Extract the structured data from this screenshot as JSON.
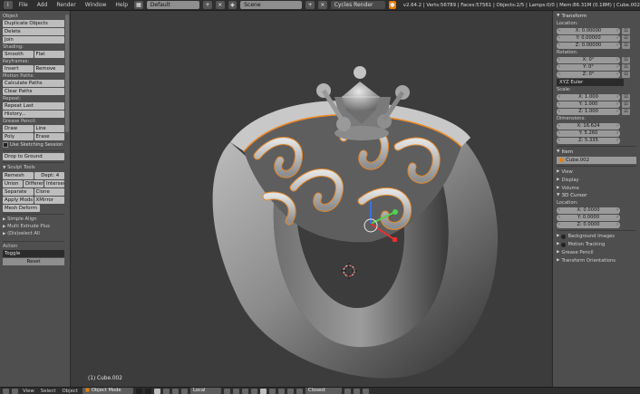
{
  "topbar": {
    "menus": [
      "File",
      "Add",
      "Render",
      "Window",
      "Help"
    ],
    "layout": "Default",
    "scene": "Scene",
    "engine": "Cycles Render",
    "stats": "v2.64.2 | Verts:56789 | Faces:57561 | Objects:2/5 | Lamps:0/0 | Mem:86.31M (0.18M) | Cube.002"
  },
  "toolshelf": {
    "top_label": "Object",
    "object_buttons": [
      "Duplicate Objects",
      "Delete",
      "Join"
    ],
    "shading_label": "Shading:",
    "shading_buttons": [
      "Smooth",
      "Flat"
    ],
    "keyframes_label": "Keyframes:",
    "keyframe_buttons": [
      "Insert",
      "Remove"
    ],
    "motion_label": "Motion Paths:",
    "motion_buttons": [
      "Calculate Paths",
      "Clear Paths"
    ],
    "repeat_label": "Repeat:",
    "repeat_buttons": [
      "Repeat Last",
      "History..."
    ],
    "grease_label": "Grease Pencil:",
    "grease_row1": [
      "Draw",
      "Line"
    ],
    "grease_row2": [
      "Poly",
      "Erase"
    ],
    "sketching_label": "Use Sketching Session",
    "drop_button": "Drop to Ground",
    "sculpt_panel": "Sculpt Tools",
    "remesh_button": "Remesh",
    "depth_value": "Dept: 4",
    "bool_row": [
      "Union",
      "Difference",
      "Intersect"
    ],
    "sep_row": [
      "Separate",
      "Clone"
    ],
    "mods_row": [
      "Apply Mods",
      "XMirror"
    ],
    "mesh_deform": "Mesh Deform",
    "collapsed": [
      "Simple Align",
      "Multi Extrude Plus",
      "(Dis)select All"
    ],
    "action_label": "Action",
    "action_value": "Toggle",
    "reset_button": "Reset"
  },
  "viewport": {
    "object_label": "(1) Cube.002"
  },
  "properties": {
    "transform_title": "Transform",
    "location_label": "Location:",
    "location": [
      "X: 0.00000",
      "Y: 0.00000",
      "Z: 0.00000"
    ],
    "rotation_label": "Rotation:",
    "rotation": [
      "X: 0°",
      "Y: 0°",
      "Z: 0°"
    ],
    "rotation_mode": "XYZ Euler",
    "scale_label": "Scale:",
    "scale": [
      "X: 1.000",
      "Y: 1.000",
      "Z: 1.000"
    ],
    "dimensions_label": "Dimensions:",
    "dimensions": [
      "X: 16.624",
      "Y: 5.260",
      "Z: 5.335"
    ],
    "item_title": "Item",
    "item_name": "Cube.002",
    "view_sections": [
      "View",
      "Display",
      "Volume"
    ],
    "cursor_title": "3D Cursor",
    "cursor_location_label": "Location:",
    "cursor_location": [
      "X: 0.0000",
      "Y: 0.0000",
      "Z: 0.0000"
    ],
    "extra_sections": [
      "Background Images",
      "Motion Tracking",
      "Grease Pencil",
      "Transform Orientations"
    ]
  },
  "bottombar": {
    "menus": [
      "View",
      "Select",
      "Object"
    ],
    "mode": "Object Mode",
    "orientation": "Local",
    "snap": "Closest"
  },
  "colors": {
    "selection_orange": "#f08a24",
    "gizmo_green": "#4fd04f",
    "gizmo_red": "#e63030",
    "gizmo_blue": "#3c6ee6"
  }
}
